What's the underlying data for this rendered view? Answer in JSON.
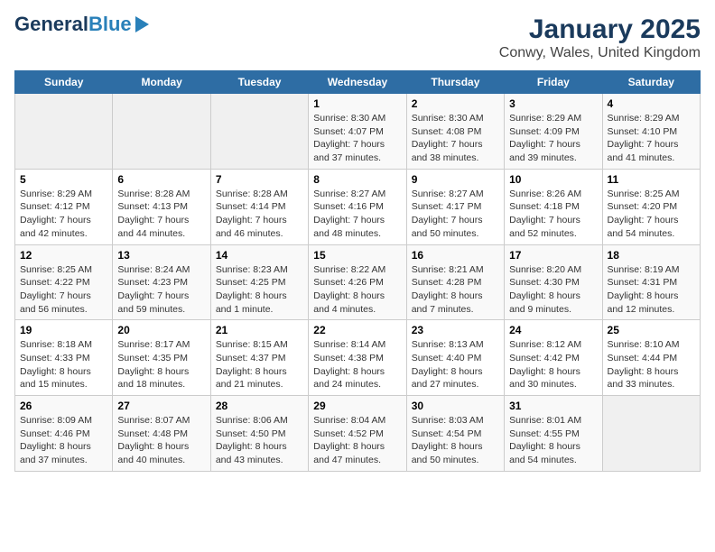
{
  "logo": {
    "text1": "General",
    "text2": "Blue"
  },
  "title": "January 2025",
  "subtitle": "Conwy, Wales, United Kingdom",
  "days": [
    "Sunday",
    "Monday",
    "Tuesday",
    "Wednesday",
    "Thursday",
    "Friday",
    "Saturday"
  ],
  "weeks": [
    [
      {
        "day": "",
        "info": ""
      },
      {
        "day": "",
        "info": ""
      },
      {
        "day": "",
        "info": ""
      },
      {
        "day": "1",
        "info": "Sunrise: 8:30 AM\nSunset: 4:07 PM\nDaylight: 7 hours and 37 minutes."
      },
      {
        "day": "2",
        "info": "Sunrise: 8:30 AM\nSunset: 4:08 PM\nDaylight: 7 hours and 38 minutes."
      },
      {
        "day": "3",
        "info": "Sunrise: 8:29 AM\nSunset: 4:09 PM\nDaylight: 7 hours and 39 minutes."
      },
      {
        "day": "4",
        "info": "Sunrise: 8:29 AM\nSunset: 4:10 PM\nDaylight: 7 hours and 41 minutes."
      }
    ],
    [
      {
        "day": "5",
        "info": "Sunrise: 8:29 AM\nSunset: 4:12 PM\nDaylight: 7 hours and 42 minutes."
      },
      {
        "day": "6",
        "info": "Sunrise: 8:28 AM\nSunset: 4:13 PM\nDaylight: 7 hours and 44 minutes."
      },
      {
        "day": "7",
        "info": "Sunrise: 8:28 AM\nSunset: 4:14 PM\nDaylight: 7 hours and 46 minutes."
      },
      {
        "day": "8",
        "info": "Sunrise: 8:27 AM\nSunset: 4:16 PM\nDaylight: 7 hours and 48 minutes."
      },
      {
        "day": "9",
        "info": "Sunrise: 8:27 AM\nSunset: 4:17 PM\nDaylight: 7 hours and 50 minutes."
      },
      {
        "day": "10",
        "info": "Sunrise: 8:26 AM\nSunset: 4:18 PM\nDaylight: 7 hours and 52 minutes."
      },
      {
        "day": "11",
        "info": "Sunrise: 8:25 AM\nSunset: 4:20 PM\nDaylight: 7 hours and 54 minutes."
      }
    ],
    [
      {
        "day": "12",
        "info": "Sunrise: 8:25 AM\nSunset: 4:22 PM\nDaylight: 7 hours and 56 minutes."
      },
      {
        "day": "13",
        "info": "Sunrise: 8:24 AM\nSunset: 4:23 PM\nDaylight: 7 hours and 59 minutes."
      },
      {
        "day": "14",
        "info": "Sunrise: 8:23 AM\nSunset: 4:25 PM\nDaylight: 8 hours and 1 minute."
      },
      {
        "day": "15",
        "info": "Sunrise: 8:22 AM\nSunset: 4:26 PM\nDaylight: 8 hours and 4 minutes."
      },
      {
        "day": "16",
        "info": "Sunrise: 8:21 AM\nSunset: 4:28 PM\nDaylight: 8 hours and 7 minutes."
      },
      {
        "day": "17",
        "info": "Sunrise: 8:20 AM\nSunset: 4:30 PM\nDaylight: 8 hours and 9 minutes."
      },
      {
        "day": "18",
        "info": "Sunrise: 8:19 AM\nSunset: 4:31 PM\nDaylight: 8 hours and 12 minutes."
      }
    ],
    [
      {
        "day": "19",
        "info": "Sunrise: 8:18 AM\nSunset: 4:33 PM\nDaylight: 8 hours and 15 minutes."
      },
      {
        "day": "20",
        "info": "Sunrise: 8:17 AM\nSunset: 4:35 PM\nDaylight: 8 hours and 18 minutes."
      },
      {
        "day": "21",
        "info": "Sunrise: 8:15 AM\nSunset: 4:37 PM\nDaylight: 8 hours and 21 minutes."
      },
      {
        "day": "22",
        "info": "Sunrise: 8:14 AM\nSunset: 4:38 PM\nDaylight: 8 hours and 24 minutes."
      },
      {
        "day": "23",
        "info": "Sunrise: 8:13 AM\nSunset: 4:40 PM\nDaylight: 8 hours and 27 minutes."
      },
      {
        "day": "24",
        "info": "Sunrise: 8:12 AM\nSunset: 4:42 PM\nDaylight: 8 hours and 30 minutes."
      },
      {
        "day": "25",
        "info": "Sunrise: 8:10 AM\nSunset: 4:44 PM\nDaylight: 8 hours and 33 minutes."
      }
    ],
    [
      {
        "day": "26",
        "info": "Sunrise: 8:09 AM\nSunset: 4:46 PM\nDaylight: 8 hours and 37 minutes."
      },
      {
        "day": "27",
        "info": "Sunrise: 8:07 AM\nSunset: 4:48 PM\nDaylight: 8 hours and 40 minutes."
      },
      {
        "day": "28",
        "info": "Sunrise: 8:06 AM\nSunset: 4:50 PM\nDaylight: 8 hours and 43 minutes."
      },
      {
        "day": "29",
        "info": "Sunrise: 8:04 AM\nSunset: 4:52 PM\nDaylight: 8 hours and 47 minutes."
      },
      {
        "day": "30",
        "info": "Sunrise: 8:03 AM\nSunset: 4:54 PM\nDaylight: 8 hours and 50 minutes."
      },
      {
        "day": "31",
        "info": "Sunrise: 8:01 AM\nSunset: 4:55 PM\nDaylight: 8 hours and 54 minutes."
      },
      {
        "day": "",
        "info": ""
      }
    ]
  ]
}
